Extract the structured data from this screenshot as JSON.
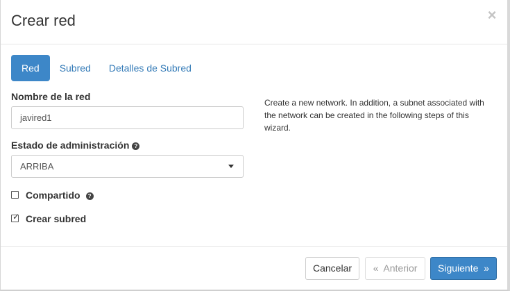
{
  "modal": {
    "title": "Crear red",
    "close_glyph": "×"
  },
  "tabs": [
    {
      "label": "Red",
      "active": true
    },
    {
      "label": "Subred",
      "active": false
    },
    {
      "label": "Detalles de Subred",
      "active": false
    }
  ],
  "form": {
    "network_name": {
      "label": "Nombre de la red",
      "value": "javired1"
    },
    "admin_state": {
      "label": "Estado de administración",
      "help_icon": "question-circle-icon",
      "selected": "ARRIBA"
    },
    "shared": {
      "label": "Compartido",
      "checked": false,
      "help_icon": "question-circle-icon"
    },
    "create_subnet": {
      "label": "Crear subred",
      "checked": true,
      "checkmark": "✓"
    }
  },
  "description": "Create a new network. In addition, a subnet associated with the network can be created in the following steps of this wizard.",
  "footer": {
    "cancel": "Cancelar",
    "previous_glyph": "«",
    "previous": "Anterior",
    "next": "Siguiente",
    "next_glyph": "»"
  },
  "colors": {
    "primary": "#3d87c8",
    "link": "#337ab7"
  }
}
